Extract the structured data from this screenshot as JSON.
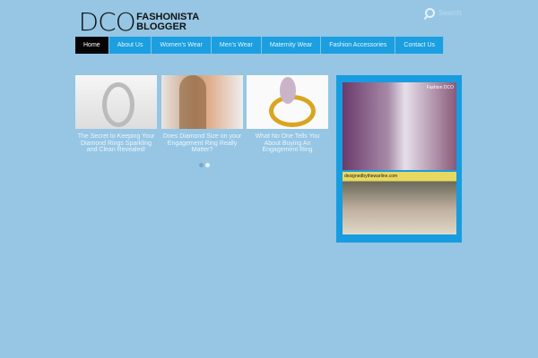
{
  "logo": {
    "main": "DCO",
    "line1": "FASHONISTA",
    "line2": "BLOGGER"
  },
  "search": {
    "placeholder": "Search"
  },
  "nav": [
    "Home",
    "About Us",
    "Women's Wear",
    "Men's Wear",
    "Maternity Wear",
    "Fashion Accessories",
    "Contact Us"
  ],
  "posts": [
    {
      "title": "The Secret to Keeping Your Diamond Rings Sparkling and Clean Revealed!"
    },
    {
      "title": "Does Diamond Size on your Engagement Ring Really Matter?"
    },
    {
      "title": "What No One Tells You About Buying An Engagement Ring"
    }
  ],
  "sidebar": {
    "photo1_caption": "Fashion DCO",
    "photo2_caption": "designedbythewarline.com"
  }
}
